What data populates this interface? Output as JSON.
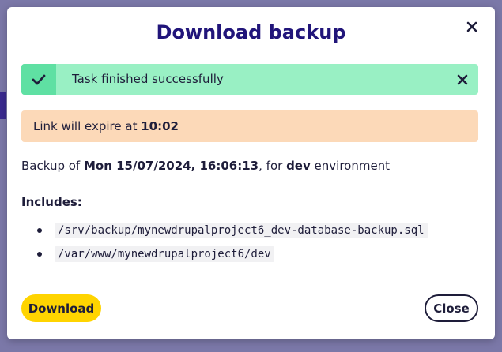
{
  "modal": {
    "title": "Download backup",
    "close_icon": "close-icon"
  },
  "success_alert": {
    "text": "Task finished successfully",
    "icon": "check-icon",
    "dismiss_icon": "close-icon",
    "color": "#99f0c4"
  },
  "expiry_alert": {
    "prefix": "Link will expire at ",
    "time": "10:02",
    "color": "#fcd9b8"
  },
  "backup": {
    "prefix": "Backup of ",
    "datetime": "Mon 15/07/2024, 16:06:13",
    "middle": ", for ",
    "environment": "dev",
    "suffix": " environment"
  },
  "includes": {
    "label": "Includes:",
    "items": [
      "/srv/backup/mynewdrupalproject6_dev-database-backup.sql",
      "/var/www/mynewdrupalproject6/dev"
    ]
  },
  "actions": {
    "download_label": "Download",
    "close_label": "Close",
    "download_color": "#ffd400"
  },
  "colors": {
    "title": "#21157a",
    "text": "#1e1d3a"
  }
}
